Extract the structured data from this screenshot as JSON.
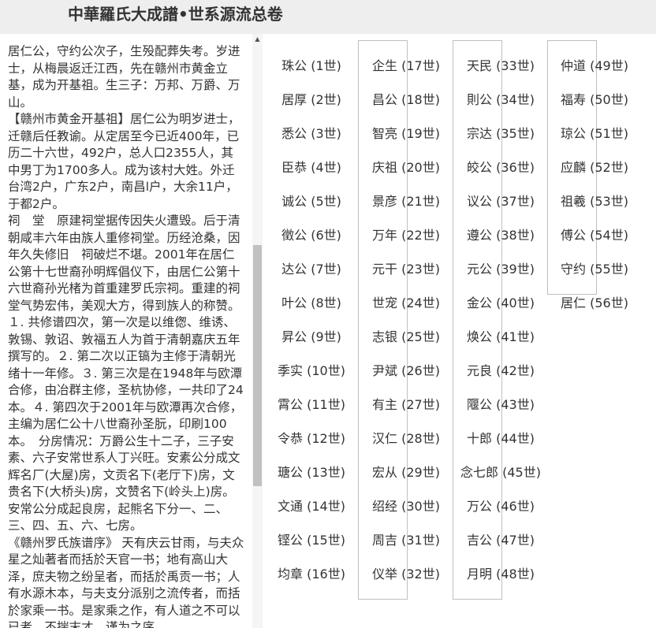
{
  "header": {
    "title": "中華羅氏大成譜•世系源流总卷"
  },
  "left_text": {
    "paragraphs": [
      "居仁公，守约公次子，生殁配葬失考。岁进士，从梅晨返迁江西，先在赣州市黄金立基，成为开基祖。生三子：万邦、万爵、万山。",
      "【赣州市黄金开基祖】居仁公为明岁进士，迁赣后任教谕。从定居至今已近400年，已历二十六世，492户，总人口2355人，其中男丁为1700多人。成为该村大姓。外迁台湾2户，广东2户，南昌l户，大余11户，于都2户。",
      "祠　堂　原建祠堂据传因失火遭毁。后于清朝咸丰六年由族人重修祠堂。历经沧桑，因年久失修旧　祠破烂不堪。2001年在居仁公第十七世裔孙明辉倡仪下，由居仁公第十六世裔孙光楮为首重建罗氏宗祠。重建的祠堂气势宏伟，美观大方，得到族人的称赞。１. 共修谱四次，第一次是以维偬、维诱、敦锡、敦诏、敦福五人为首于清朝嘉庆五年撰写的。２. 第二次以正镐为主修于清朝光绪十一年修。３. 第三次是在1948年与欧潭合修，由冶群主修，圣杭协修，一共印了24本。４. 第四次于2001年与欧潭再次合修，主编为居仁公十八世裔孙圣朊，印刷100本。　分房情况：万爵公生十二子，三子安素、六子安常世系人丁兴旺。安素公分成文辉名厂(大屋)房，文贡名下(老厅下)房，文贵名下(大桥头)房，文赞名下(岭头上)房。安常公分成起良房，起熊名下分一、二、三、四、五、六、七房。",
      "《赣州罗氏族谱序》 天有庆云甘雨，与夫众星之灿著者而括於天官一书；地有高山大泽，庶夫物之纷呈者，而括於禹贡一书；人有水源木本，与夫支分派别之流传者，而括於家乘一书。是家乘之作，有人道之不可以已者。不揣末才，谨为之序"
    ]
  },
  "generations": {
    "col1": [
      "珠公 (1世)",
      "居厚 (2世)",
      "悉公 (3世)",
      "臣恭 (4世)",
      "诚公 (5世)",
      "徵公 (6世)",
      "达公 (7世)",
      "叶公 (8世)",
      "昇公 (9世)",
      "季实 (10世)",
      "霄公 (11世)",
      "令恭 (12世)",
      "瑭公 (13世)",
      "文通 (14世)",
      "铿公 (15世)",
      "均章 (16世)"
    ],
    "col2": [
      "企生 (17世)",
      "昌公 (18世)",
      "智亮 (19世)",
      "庆祖 (20世)",
      "景彦 (21世)",
      "万年 (22世)",
      "元干 (23世)",
      "世宠 (24世)",
      "志银 (25世)",
      "尹斌 (26世)",
      "有主 (27世)",
      "汉仁 (28世)",
      "宏从 (29世)",
      "绍经 (30世)",
      "周吉 (31世)",
      "仪举 (32世)"
    ],
    "col3": [
      "天民 (33世)",
      "則公 (34世)",
      "宗达 (35世)",
      "皎公 (36世)",
      "议公 (37世)",
      "遵公 (38世)",
      "元公 (39世)",
      "金公 (40世)",
      "焕公 (41世)",
      "元良 (42世)",
      "隁公 (43世)",
      "十郎 (44世)",
      "念七郎 (45世)",
      "万公 (46世)",
      "吉公 (47世)",
      "月明 (48世)"
    ],
    "col4": [
      "仲道 (49世)",
      "福寿 (50世)",
      "琼公 (51世)",
      "应麟 (52世)",
      "祖羲 (53世)",
      "傅公 (54世)",
      "守约 (55世)",
      "居仁 (56世)"
    ]
  },
  "colors": {
    "header_bg": "#eeeeee",
    "text": "#333333",
    "border": "#bfbfbf",
    "scroll_thumb": "#c1c1c1"
  }
}
